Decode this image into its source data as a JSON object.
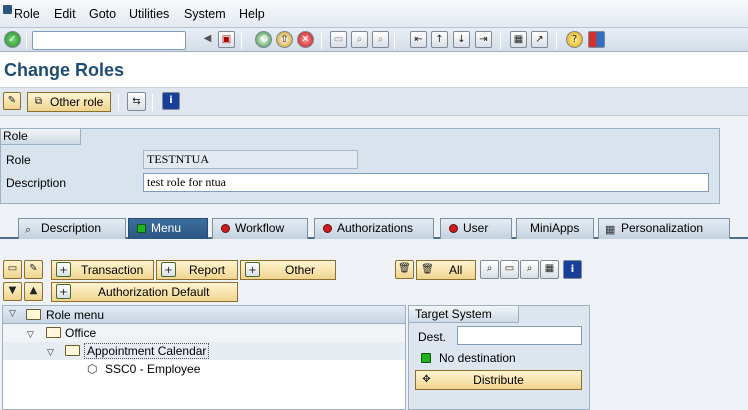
{
  "menu": [
    "Role",
    "Edit",
    "Goto",
    "Utilities",
    "System",
    "Help"
  ],
  "page_title": "Change Roles",
  "toolbar": {
    "other_role": "Other role"
  },
  "role_panel": {
    "heading": "Role",
    "role_label": "Role",
    "role_value": "TESTNTUA",
    "desc_label": "Description",
    "desc_value": "test role for ntua"
  },
  "tabs": [
    "Description",
    "Menu",
    "Workflow",
    "Authorizations",
    "User",
    "MiniApps",
    "Personalization"
  ],
  "menu_toolbar": {
    "transaction": "Transaction",
    "report": "Report",
    "other": "Other",
    "auth_default": "Authorization Default",
    "all": "All"
  },
  "tree": {
    "header": "Role menu",
    "office": "Office",
    "calendar": "Appointment Calendar",
    "employee": "SSC0 - Employee"
  },
  "target": {
    "heading": "Target System",
    "dest_label": "Dest.",
    "dest_value": "",
    "status": "No destination",
    "distribute": "Distribute"
  },
  "colors": {
    "title": "#1f4d73",
    "active_tab": "#2a5682",
    "button": "#f0d48e",
    "status_ok": "#1fb31f",
    "status_err": "#d21c1c"
  }
}
